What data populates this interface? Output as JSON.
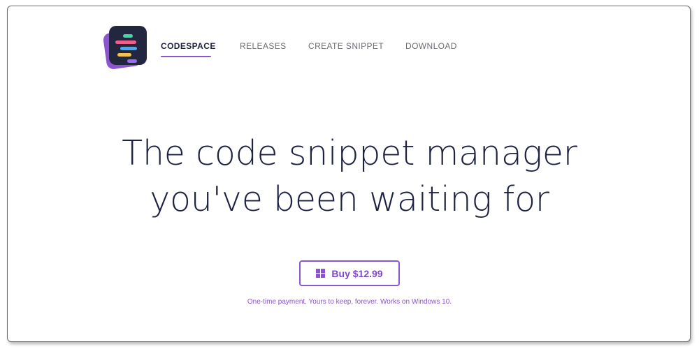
{
  "brand": {
    "logo_icon": "code-snippet-stack-logo",
    "accent_color": "#8a55cf",
    "text_color": "#1d2242"
  },
  "nav": {
    "items": [
      {
        "label": "CODESPACE",
        "active": true
      },
      {
        "label": "RELEASES",
        "active": false
      },
      {
        "label": "CREATE SNIPPET",
        "active": false
      },
      {
        "label": "DOWNLOAD",
        "active": false
      }
    ]
  },
  "hero": {
    "title_line1": "The code snippet manager",
    "title_line2": "you've been waiting for"
  },
  "cta": {
    "icon": "windows-icon",
    "label": "Buy $12.99",
    "note": "One-time payment. Yours to keep, forever. Works on Windows 10."
  }
}
